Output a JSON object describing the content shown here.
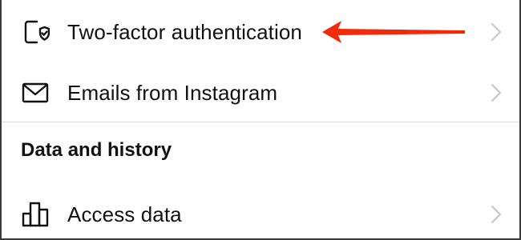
{
  "settings": {
    "items": [
      {
        "label": "Two-factor authentication",
        "icon": "phone-shield-icon"
      },
      {
        "label": "Emails from Instagram",
        "icon": "envelope-icon"
      }
    ],
    "data_section": {
      "header": "Data and history",
      "items": [
        {
          "label": "Access data",
          "icon": "bar-chart-icon"
        }
      ]
    }
  },
  "annotation": {
    "arrow_color": "#f22a0c"
  }
}
